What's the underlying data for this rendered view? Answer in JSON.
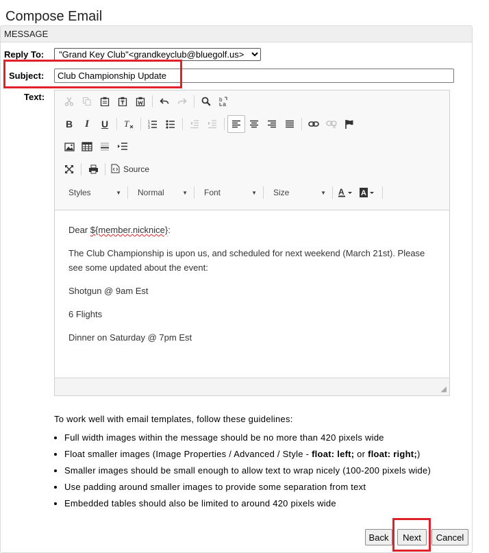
{
  "page": {
    "title": "Compose Email"
  },
  "panel": {
    "header": "MESSAGE"
  },
  "form": {
    "reply_to_label": "Reply To:",
    "reply_to_value": "\"Grand Key Club\"<grandkeyclub@bluegolf.us>",
    "subject_label": "Subject:",
    "subject_value": "Club Championship Update",
    "text_label": "Text:"
  },
  "editor": {
    "toolbar": {
      "row1": [
        "cut-icon",
        "copy-icon",
        "paste-icon",
        "paste-text-icon",
        "paste-word-icon",
        "undo-icon",
        "redo-icon",
        "find-icon",
        "replace-icon"
      ],
      "row2": [
        "bold-icon",
        "italic-icon",
        "underline-icon",
        "remove-format-icon",
        "numbered-list-icon",
        "bulleted-list-icon",
        "outdent-icon",
        "indent-icon",
        "align-left-icon",
        "align-center-icon",
        "align-right-icon",
        "justify-icon",
        "link-icon",
        "unlink-icon",
        "anchor-icon"
      ],
      "row3": [
        "image-icon",
        "table-icon",
        "horizontal-line-icon",
        "page-break-icon"
      ],
      "row4": [
        "maximize-icon",
        "print-icon",
        "source-icon"
      ],
      "source_label": "Source",
      "styles_label": "Styles",
      "format_label": "Normal",
      "font_label": "Font",
      "size_label": "Size"
    },
    "content": {
      "greeting_prefix": "Dear ",
      "greeting_variable": "${member.nicknice}",
      "greeting_suffix": ":",
      "paragraph1": "The Club Championship is upon us, and scheduled for next weekend (March 21st). Please see some updated about the event:",
      "paragraph2": "Shotgun @ 9am Est",
      "paragraph3": "6 Flights",
      "paragraph4": "Dinner on Saturday @ 7pm Est"
    }
  },
  "guidelines": {
    "intro": "To work well with email templates, follow these guidelines:",
    "item1": "Full width images within the message should be no more than 420 pixels wide",
    "item2_a": "Float smaller images (Image Properties / Advanced / Style - ",
    "item2_b": "float: left;",
    "item2_c": " or ",
    "item2_d": "float: right;",
    "item2_e": ")",
    "item3": "Smaller images should be small enough to allow text to wrap nicely (100-200 pixels wide)",
    "item4": "Use padding around smaller images to provide some separation from text",
    "item5": "Embedded tables should also be limited to around 420 pixels wide"
  },
  "buttons": {
    "back": "Back",
    "next": "Next",
    "cancel": "Cancel"
  },
  "colors": {
    "highlight": "#e0202a",
    "spellcheck": "#e02020"
  }
}
